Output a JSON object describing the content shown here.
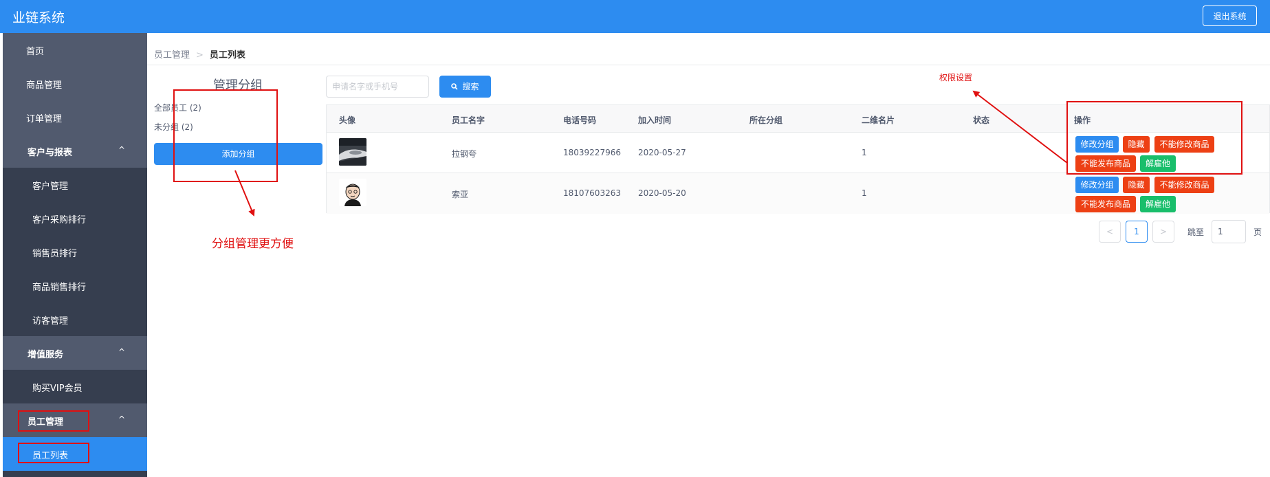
{
  "header": {
    "title": "业链系统",
    "logout_label": "退出系统"
  },
  "sidebar": {
    "home": "首页",
    "goods": "商品管理",
    "orders": "订单管理",
    "customers_group": "客户与报表",
    "customer_mgmt": "客户管理",
    "customer_purchase_rank": "客户采购排行",
    "salesperson_rank": "销售员排行",
    "goods_sales_rank": "商品销售排行",
    "visitor_mgmt": "访客管理",
    "value_added_group": "增值服务",
    "buy_vip": "购买VIP会员",
    "staff_group": "员工管理",
    "staff_list": "员工列表",
    "chevron": "^"
  },
  "breadcrumb": {
    "parent": "员工管理",
    "sep": ">",
    "current": "员工列表"
  },
  "groups": {
    "title": "管理分组",
    "all": "全部员工 (2)",
    "ungrouped": "未分组 (2)",
    "add_label": "添加分组"
  },
  "search": {
    "placeholder": "申请名字或手机号",
    "button_label": "搜索"
  },
  "table": {
    "columns": [
      "头像",
      "员工名字",
      "电话号码",
      "加入时间",
      "所在分组",
      "二维名片",
      "状态",
      "操作"
    ],
    "rows": [
      {
        "avatar": "photo-avatar",
        "name": "拉钢夸",
        "phone": "18039227966",
        "joined": "2020-05-27",
        "group": "",
        "qr": "1",
        "status": ""
      },
      {
        "avatar": "cartoon-avatar",
        "name": "索亚",
        "phone": "18107603263",
        "joined": "2020-05-20",
        "group": "",
        "qr": "1",
        "status": ""
      }
    ],
    "actions": {
      "edit_group": "修改分组",
      "hide": "隐藏",
      "no_edit_goods": "不能修改商品",
      "no_publish_goods": "不能发布商品",
      "dismiss": "解雇他"
    }
  },
  "pagination": {
    "prev": "<",
    "current": "1",
    "next": ">",
    "jump_label": "跳至",
    "jump_value": "1",
    "page_suffix": "页"
  },
  "annotations": {
    "group_note": "分组管理更方便",
    "permission_note": "权限设置"
  },
  "colors": {
    "primary": "#2d8cf0",
    "sidebar": "#515a6e",
    "sidebar_sub": "#363e4f",
    "danger": "#ed4014",
    "success": "#19be6b",
    "annotation": "#e01010"
  }
}
